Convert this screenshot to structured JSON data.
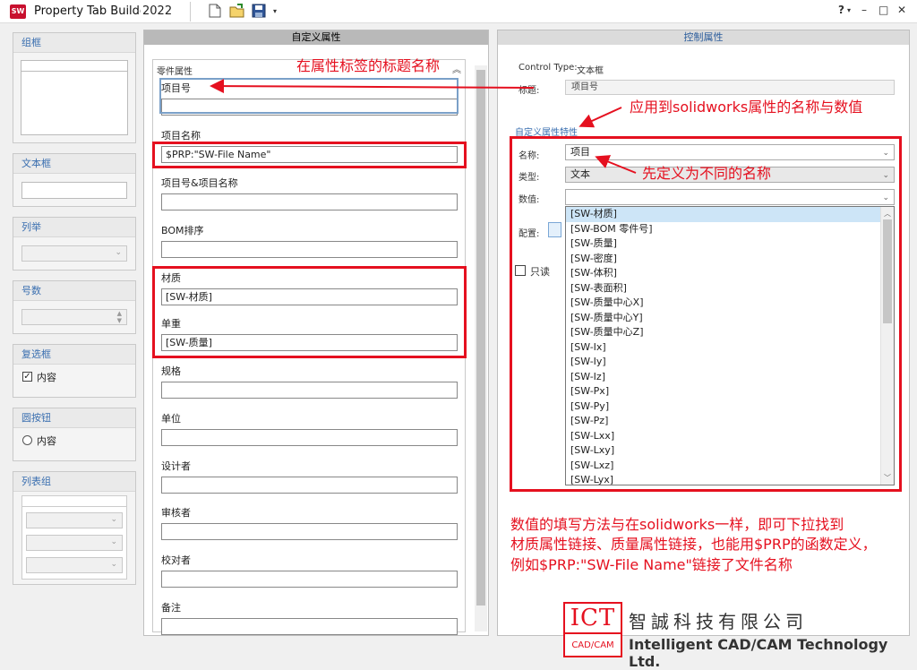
{
  "window": {
    "app_icon": "SW",
    "title": "Property Tab Builde",
    "version": "2022",
    "help": "?",
    "help_arrow": "▾",
    "minimize": "–",
    "maximize": "□",
    "close": "✕"
  },
  "toolbar": {
    "new_icon": "new-document-icon",
    "open_icon": "open-folder-icon",
    "save_icon": "save-icon"
  },
  "palette": {
    "group_box": "组框",
    "textbox": "文本框",
    "list": "列举",
    "number": "号数",
    "checkbox": "复选框",
    "checkbox_label": "内容",
    "radio": "圆按钮",
    "radio_label": "内容",
    "listgroup": "列表组"
  },
  "custom_props": {
    "header": "自定义属性",
    "group_title": "零件属性",
    "fields": [
      {
        "label": "项目号",
        "value": ""
      },
      {
        "label": "项目名称",
        "value": "$PRP:\"SW-File Name\""
      },
      {
        "label": "项目号&项目名称",
        "value": ""
      },
      {
        "label": "BOM排序",
        "value": ""
      },
      {
        "label": "材质",
        "value": "[SW-材质]"
      },
      {
        "label": "单重",
        "value": "[SW-质量]"
      },
      {
        "label": "规格",
        "value": ""
      },
      {
        "label": "单位",
        "value": ""
      },
      {
        "label": "设计者",
        "value": ""
      },
      {
        "label": "审核者",
        "value": ""
      },
      {
        "label": "校对者",
        "value": ""
      },
      {
        "label": "备注",
        "value": ""
      }
    ]
  },
  "control_props": {
    "header": "控制属性",
    "control_type_label": "Control Type:",
    "control_type_value": "文本框",
    "caption_label": "标题:",
    "caption_value": "项目号",
    "section": "自定义属性特性",
    "name_label": "名称:",
    "name_value": "项目",
    "type_label": "类型:",
    "type_value": "文本",
    "value_label": "数值:",
    "value_value": "",
    "config_label": "配置:",
    "readonly_label": "只读",
    "dropdown_items": [
      "[SW-材质]",
      "[SW-BOM 零件号]",
      "[SW-质量]",
      "[SW-密度]",
      "[SW-体积]",
      "[SW-表面积]",
      "[SW-质量中心X]",
      "[SW-质量中心Y]",
      "[SW-质量中心Z]",
      "[SW-Ix]",
      "[SW-Iy]",
      "[SW-Iz]",
      "[SW-Px]",
      "[SW-Py]",
      "[SW-Pz]",
      "[SW-Lxx]",
      "[SW-Lxy]",
      "[SW-Lxz]",
      "[SW-Lyx]"
    ]
  },
  "annotations": {
    "title_note": "在属性标签的标题名称",
    "apply_note": "应用到solidworks属性的名称与数值",
    "define_note": "先定义为不同的名称",
    "value_note_1": "数值的填写方法与在solidworks一样，即可下拉找到",
    "value_note_2": "材质属性链接、质量属性链接，也能用$PRP的函数定义，",
    "value_note_3": "例如$PRP:\"SW-File Name\"链接了文件名称"
  },
  "logo": {
    "ict": "ICT",
    "cadcam": "CAD/CAM",
    "company_cn": "智誠科技有限公司",
    "company_en": "Intelligent CAD/CAM Technology Ltd."
  }
}
